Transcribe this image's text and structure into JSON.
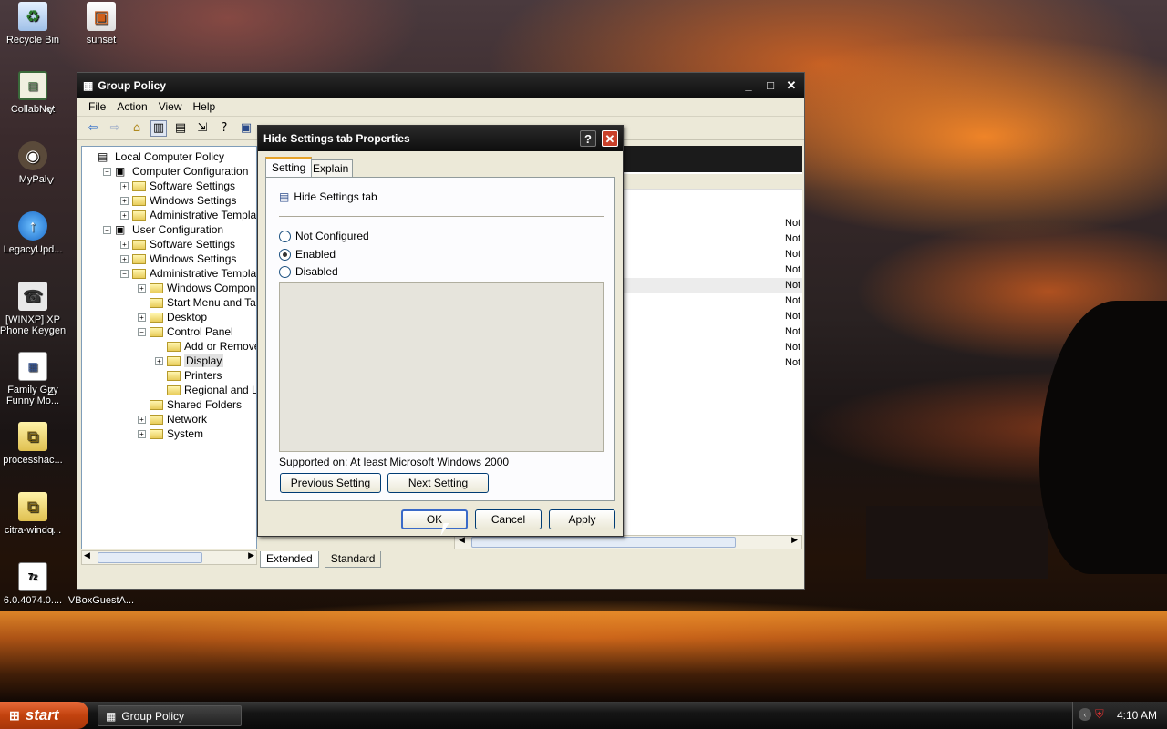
{
  "desktop_icons": [
    {
      "label": "Recycle Bin",
      "icon": "recycle-bin-icon"
    },
    {
      "label": "sunset",
      "icon": "image-file-icon"
    },
    {
      "label": "CollabNet",
      "icon": "collabnet-icon"
    },
    {
      "label": "MyPal",
      "icon": "mypal-browser-icon"
    },
    {
      "label": "LegacyUpd...",
      "icon": "legacy-update-icon"
    },
    {
      "label": "[WINXP] XP Phone Keygen",
      "icon": "phone-icon"
    },
    {
      "label": "Family Guy Funny Mo...",
      "icon": "document-icon"
    },
    {
      "label": "processhac...",
      "icon": "zip-folder-icon"
    },
    {
      "label": "citra-windo...",
      "icon": "zip-folder-icon"
    },
    {
      "label": "6.0.4074.0....",
      "icon": "7z-archive-icon"
    },
    {
      "label": "VBoxGuestA...",
      "icon": "vbox-icon"
    }
  ],
  "desktop_icon_partial_letters": [
    "V",
    "V",
    "Z",
    "l"
  ],
  "gp_window": {
    "title": "Group Policy",
    "menu": [
      "File",
      "Action",
      "View",
      "Help"
    ],
    "tree": [
      {
        "label": "Local Computer Policy",
        "indent": 0,
        "expander": ""
      },
      {
        "label": "Computer Configuration",
        "indent": 1,
        "expander": "-"
      },
      {
        "label": "Software Settings",
        "indent": 2,
        "expander": "+"
      },
      {
        "label": "Windows Settings",
        "indent": 2,
        "expander": "+"
      },
      {
        "label": "Administrative Templates",
        "indent": 2,
        "expander": "+"
      },
      {
        "label": "User Configuration",
        "indent": 1,
        "expander": "-"
      },
      {
        "label": "Software Settings",
        "indent": 2,
        "expander": "+"
      },
      {
        "label": "Windows Settings",
        "indent": 2,
        "expander": "+"
      },
      {
        "label": "Administrative Templates",
        "indent": 2,
        "expander": "-"
      },
      {
        "label": "Windows Components",
        "indent": 3,
        "expander": "+"
      },
      {
        "label": "Start Menu and Taskbar",
        "indent": 3,
        "expander": ""
      },
      {
        "label": "Desktop",
        "indent": 3,
        "expander": "+"
      },
      {
        "label": "Control Panel",
        "indent": 3,
        "expander": "-"
      },
      {
        "label": "Add or Remove Programs",
        "indent": 4,
        "expander": ""
      },
      {
        "label": "Display",
        "indent": 4,
        "expander": "+"
      },
      {
        "label": "Printers",
        "indent": 4,
        "expander": ""
      },
      {
        "label": "Regional and Language",
        "indent": 4,
        "expander": ""
      },
      {
        "label": "Shared Folders",
        "indent": 3,
        "expander": ""
      },
      {
        "label": "Network",
        "indent": 3,
        "expander": "+"
      },
      {
        "label": "System",
        "indent": 3,
        "expander": "+"
      }
    ],
    "right_state_cells": [
      "Not",
      "Not",
      "Not",
      "Not",
      "Not",
      "Not",
      "Not",
      "Not",
      "Not",
      "Not"
    ],
    "view_tabs": [
      "Extended",
      "Standard"
    ]
  },
  "dialog": {
    "title": "Hide Settings tab Properties",
    "tabs": [
      "Setting",
      "Explain"
    ],
    "policy_name": "Hide Settings tab",
    "options": [
      {
        "label": "Not Configured",
        "selected": false
      },
      {
        "label": "Enabled",
        "selected": true
      },
      {
        "label": "Disabled",
        "selected": false
      }
    ],
    "supported_label": "Supported on:",
    "supported_value": "At least Microsoft Windows 2000",
    "prev_button": "Previous Setting",
    "next_button": "Next Setting",
    "ok": "OK",
    "cancel": "Cancel",
    "apply": "Apply"
  },
  "taskbar": {
    "start": "start",
    "task": "Group Policy",
    "clock": "4:10 AM"
  }
}
